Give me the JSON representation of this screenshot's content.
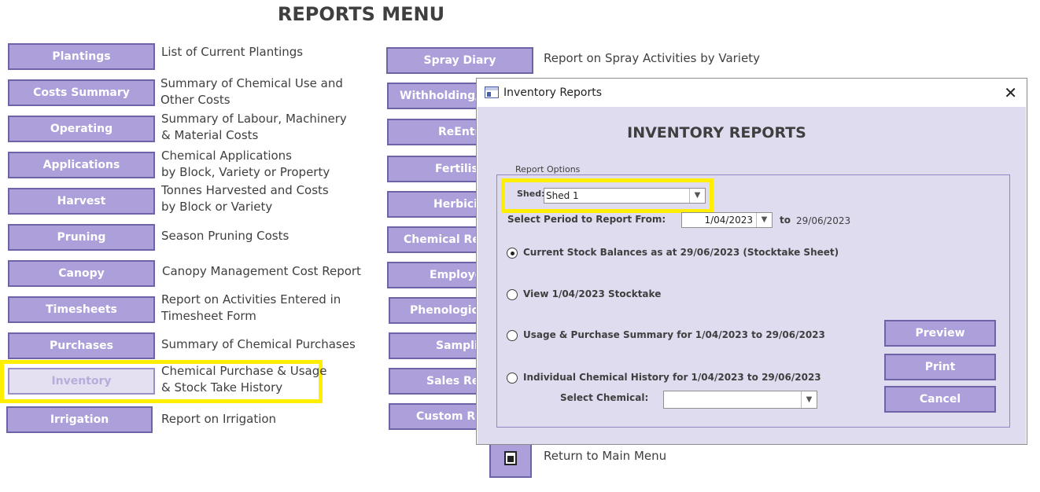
{
  "page": {
    "title": "REPORTS MENU"
  },
  "left_menu": [
    {
      "label": "Plantings",
      "desc": "List of Current Plantings"
    },
    {
      "label": "Costs Summary",
      "desc": "Summary of Chemical Use and\nOther Costs"
    },
    {
      "label": "Operating",
      "desc": "Summary of Labour, Machinery\n& Material Costs"
    },
    {
      "label": "Applications",
      "desc": "Chemical Applications\nby Block, Variety or Property"
    },
    {
      "label": "Harvest",
      "desc": "Tonnes Harvested and Costs\nby Block or Variety"
    },
    {
      "label": "Pruning",
      "desc": "Season Pruning Costs"
    },
    {
      "label": "Canopy",
      "desc": "Canopy Management Cost Report"
    },
    {
      "label": "Timesheets",
      "desc": "Report on Activities Entered in\nTimesheet Form"
    },
    {
      "label": "Purchases",
      "desc": "Summary of Chemical Purchases"
    },
    {
      "label": "Inventory",
      "desc": "Chemical Purchase & Usage\n& Stock Take History"
    },
    {
      "label": "Irrigation",
      "desc": "Report on Irrigation"
    }
  ],
  "right_menu": [
    {
      "label": "Spray Diary",
      "desc": "Report on Spray Activities by Variety"
    },
    {
      "label": "Withholding/P"
    },
    {
      "label": "ReEntr"
    },
    {
      "label": "Fertilise"
    },
    {
      "label": "Herbicid"
    },
    {
      "label": "Chemical Res"
    },
    {
      "label": "Employe"
    },
    {
      "label": "Phenologica"
    },
    {
      "label": "Samplir"
    },
    {
      "label": "Sales Rep"
    },
    {
      "label": "Custom Re"
    }
  ],
  "return_menu": {
    "label": "Return to Main Menu",
    "icon": "exit-door-icon"
  },
  "dialog": {
    "window_title": "Inventory Reports",
    "close_glyph": "✕",
    "heading": "INVENTORY REPORTS",
    "group_label": "Report Options",
    "shed_label": "Shed:",
    "shed_value": "Shed 1",
    "period_label": "Select Period to Report From:",
    "period_from": "1/04/2023",
    "to_label": "to",
    "period_to": "29/06/2023",
    "options": [
      {
        "label": "Current Stock Balances as at 29/06/2023 (Stocktake Sheet)",
        "checked": true
      },
      {
        "label": "View 1/04/2023 Stocktake",
        "checked": false
      },
      {
        "label": "Usage & Purchase Summary for 1/04/2023 to 29/06/2023",
        "checked": false
      },
      {
        "label": "Individual Chemical History for 1/04/2023 to 29/06/2023",
        "checked": false
      }
    ],
    "chemical_label": "Select Chemical:",
    "chemical_value": "",
    "buttons": {
      "preview": "Preview",
      "print": "Print",
      "cancel": "Cancel"
    }
  },
  "colors": {
    "button": "#ac9fda",
    "button_border": "#6f63a7",
    "dialog_bg": "#dfdcf0",
    "highlight": "#ffee00"
  }
}
